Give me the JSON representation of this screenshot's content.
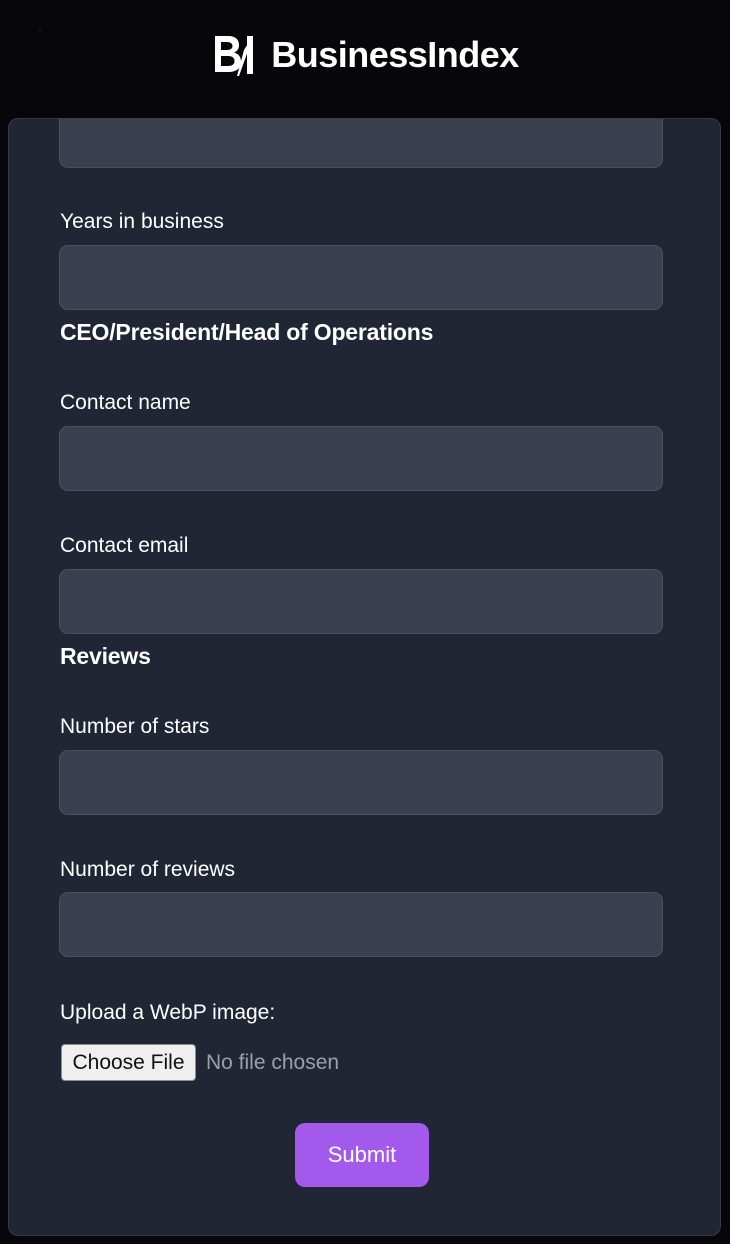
{
  "header": {
    "brand": "BusinessIndex",
    "logo_icon": "businessindex-logo-icon"
  },
  "form": {
    "fields": {
      "previous_field": {
        "value": ""
      },
      "years_in_business": {
        "label": "Years in business",
        "value": ""
      },
      "contact_name": {
        "label": "Contact name",
        "value": ""
      },
      "contact_email": {
        "label": "Contact email",
        "value": ""
      },
      "number_of_stars": {
        "label": "Number of stars",
        "value": ""
      },
      "number_of_reviews": {
        "label": "Number of reviews",
        "value": ""
      }
    },
    "sections": {
      "leadership": "CEO/President/Head of Operations",
      "reviews": "Reviews"
    },
    "upload": {
      "label": "Upload a WebP image:",
      "button": "Choose File",
      "status": "No file chosen"
    },
    "submit_label": "Submit"
  },
  "colors": {
    "background": "#07070b",
    "card": "#212634",
    "input": "#3a4050",
    "accent": "#a259ec"
  }
}
